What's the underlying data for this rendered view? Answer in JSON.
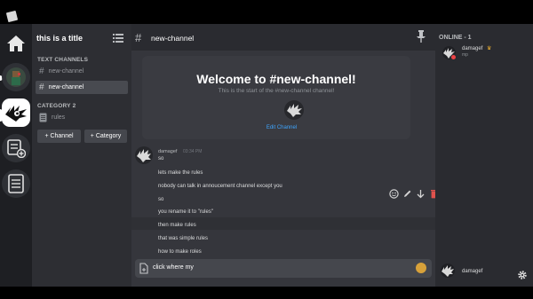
{
  "server": {
    "title": "this is a title"
  },
  "sidebar": {
    "categories": [
      {
        "label": "TEXT CHANNELS",
        "channels": [
          "new-channel",
          "new-channel"
        ]
      },
      {
        "label": "CATEGORY 2",
        "channels": [
          "rules"
        ]
      }
    ],
    "buttons": {
      "add_channel": "+ Channel",
      "add_category": "+ Category"
    }
  },
  "chat": {
    "channel_name": "new-channel",
    "welcome": {
      "title": "Welcome to #new-channel!",
      "subtitle": "This is the start of the #new-channel channel!",
      "edit_label": "Edit Channel"
    },
    "message": {
      "author": "damagef",
      "time": "03:34 PM",
      "lines": [
        "so",
        "lets make the rules",
        "nobody can talk in annoucement channel except you",
        "so",
        "you rename it to \"rules\"",
        "then make rules",
        "that was simple rules",
        "how to make roles"
      ]
    },
    "composer": {
      "value": "click where my"
    }
  },
  "members": {
    "header": "ONLINE - 1",
    "list": [
      {
        "name": "damagef",
        "sub": "mp",
        "status_color": "#ed4245"
      }
    ],
    "self_name": "damagef"
  },
  "colors": {
    "accent_link": "#3ea6ff",
    "danger": "#ed4245"
  }
}
